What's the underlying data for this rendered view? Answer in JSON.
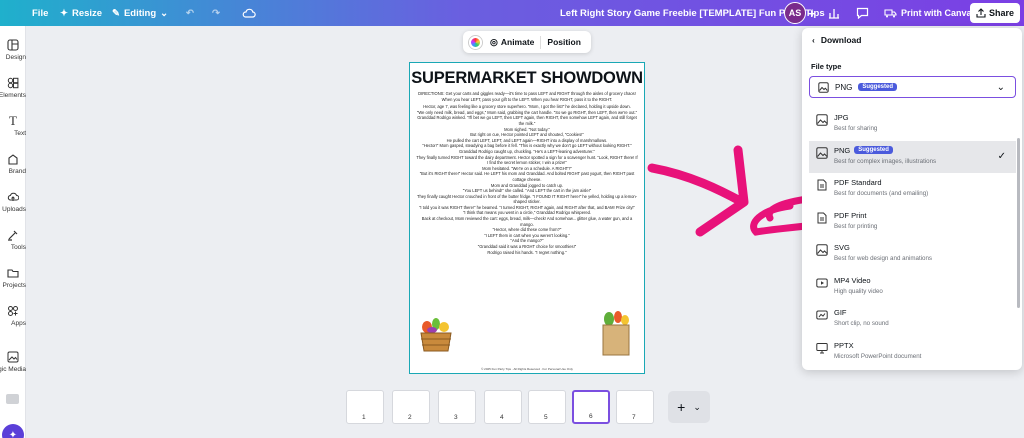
{
  "topbar": {
    "file": "File",
    "resize": "Resize",
    "editing": "Editing",
    "title": "Left Right Story Game Freebie [TEMPLATE] Fun Party Tips",
    "avatar": "AS",
    "print": "Print with Canva",
    "share": "Share"
  },
  "sidebar": {
    "items": [
      {
        "label": "Design",
        "icon": "design-icon"
      },
      {
        "label": "Elements",
        "icon": "elements-icon"
      },
      {
        "label": "Text",
        "icon": "text-icon"
      },
      {
        "label": "Brand",
        "icon": "brand-icon"
      },
      {
        "label": "Uploads",
        "icon": "uploads-icon"
      },
      {
        "label": "Tools",
        "icon": "tools-icon"
      },
      {
        "label": "Projects",
        "icon": "projects-icon"
      },
      {
        "label": "Apps",
        "icon": "apps-icon"
      },
      {
        "label": "Magic Media",
        "icon": "magic-media-icon"
      }
    ]
  },
  "context": {
    "animate": "Animate",
    "position": "Position"
  },
  "page": {
    "title": "SUPERMARKET SHOWDOWN",
    "paragraphs": [
      "DIRECTIONS: Get your carts and giggles ready—it's time to pass LEFT and RIGHT through the aisles of grocery chaos! When you hear LEFT, pass your gift to the LEFT. When you hear RIGHT, pass it to the RIGHT.",
      "Hector, age 7, was feeling like a grocery store superhero. \"Mom, I got the list!\" he declared, holding it upside down.",
      "\"We only need milk, bread, and eggs,\" Mom said, grabbing the cart handle. \"So we go RIGHT, then LEFT, then we're out.\"",
      "Granddad Rodrigo winked. \"I'll bet we go LEFT, then LEFT again, then RIGHT, then somehow LEFT again, and still forget the milk.\"",
      "Mom sighed. \"Not today.\"",
      "But right on cue, Hector pointed LEFT and shouted, \"Cookies!\"",
      "He pulled the cart LEFT, LEFT, and LEFT again—RIGHT into a display of marshmallows.",
      "\"Hector!\" Mom gasped, steadying a bag before it fell. \"This is exactly why we don't go LEFT without looking RIGHT.\"",
      "Granddad Rodrigo caught up, chuckling. \"He's a LEFT-leaning adventurer.\"",
      "They finally turned RIGHT toward the dairy department. Hector spotted a sign for a scavenger hunt. \"Look, RIGHT there! If I find the secret lemon sticker, I win a prize!\"",
      "Mom hesitated. \"We're on a schedule. A RIGHT?\"",
      "\"But it's RIGHT there!\" Hector said. He LEFT his mom and Granddad. And bolted RIGHT past yogurt, then RIGHT past cottage cheese.",
      "Mom and Granddad jogged to catch up.",
      "\"You LEFT us behind!\" she called. \"And LEFT the cart in the jam aisle!\"",
      "They finally caught Hector crouched in front of the butter fridge. \"I FOUND IT RIGHT here!\" he yelled, holding up a lemon-shaped sticker.",
      "\"I told you it was RIGHT there!\" he beamed. \"I turned RIGHT, RIGHT again, and RIGHT after that, and BAM! Prize city!\"",
      "\"I think that means you went in a circle,\" Granddad Rodrigo whispered.",
      "Back at checkout, Mom reviewed the cart: eggs, bread, milk—check! And somehow... glitter glue, a water gun, and a mango.",
      "\"Hector, where did these come from?\"",
      "\"I LEFT them in cart when you weren't looking.\"",
      "\"And the mango?\"",
      "\"Granddad said it was a RIGHT choice for smoothies!\"",
      "Rodrigo raised his hands. \"I regret nothing.\""
    ],
    "footer": "© 2025 Fun Party Tips · All Rights Reserved · For Personal Use Only"
  },
  "thumbnails": [
    "1",
    "2",
    "3",
    "4",
    "5",
    "6",
    "7"
  ],
  "download": {
    "header": "Download",
    "file_type_label": "File type",
    "selected": "PNG",
    "selected_badge": "Suggested",
    "options": [
      {
        "name": "JPG",
        "desc": "Best for sharing",
        "icon": "image-icon"
      },
      {
        "name": "PNG",
        "badge": "Suggested",
        "desc": "Best for complex images, illustrations",
        "icon": "image-icon",
        "selected": true
      },
      {
        "name": "PDF Standard",
        "desc": "Best for documents (and emailing)",
        "icon": "document-icon"
      },
      {
        "name": "PDF Print",
        "desc": "Best for printing",
        "icon": "document-icon"
      },
      {
        "name": "SVG",
        "desc": "Best for web design and animations",
        "icon": "image-icon"
      },
      {
        "name": "MP4 Video",
        "desc": "High quality video",
        "icon": "video-icon"
      },
      {
        "name": "GIF",
        "desc": "Short clip, no sound",
        "icon": "gif-icon"
      },
      {
        "name": "PPTX",
        "desc": "Microsoft PowerPoint document",
        "icon": "presentation-icon"
      }
    ]
  },
  "colors": {
    "accent": "#7b4fe0",
    "annotation": "#e8127a",
    "page_border": "#1aa8b5"
  }
}
